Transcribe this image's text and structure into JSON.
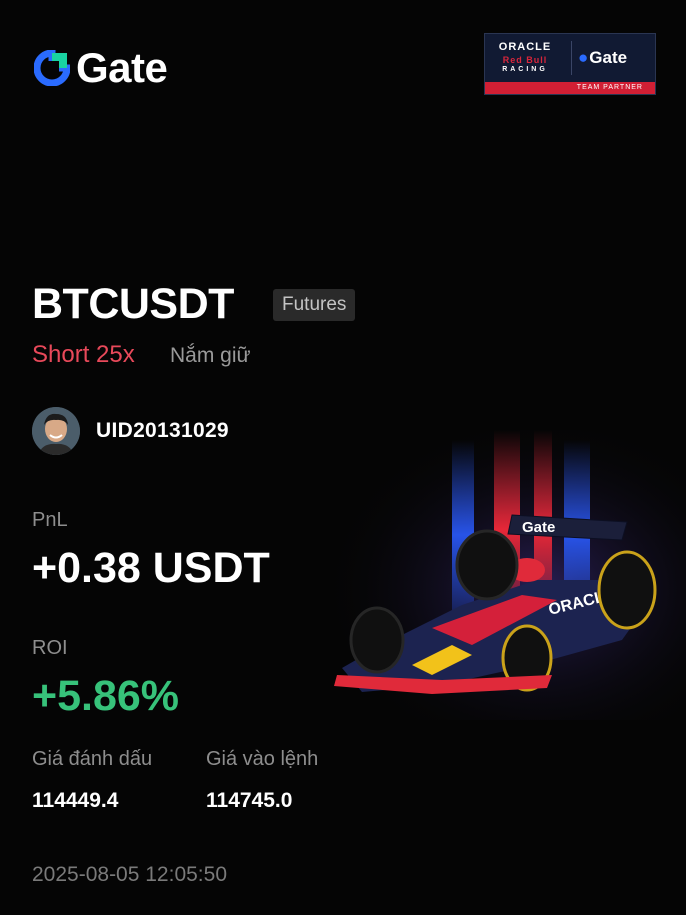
{
  "brand": {
    "name": "Gate",
    "logo_color": "#2a6bff",
    "mark_accent": "#19d3a2"
  },
  "partner_badge": {
    "oracle": "ORACLE",
    "redbull": "Red Bull",
    "racing": "RACING",
    "gate": "Gate",
    "team_partner": "TEAM PARTNER"
  },
  "position": {
    "pair": "BTCUSDT",
    "type_badge": "Futures",
    "side_leverage": "Short 25x",
    "status": "Nắm giữ",
    "side_color": "#e8495a"
  },
  "user": {
    "uid": "UID20131029",
    "avatar_icon": "user-avatar"
  },
  "pnl": {
    "label": "PnL",
    "value": "+0.38 USDT"
  },
  "roi": {
    "label": "ROI",
    "value": "+5.86%",
    "color": "#37c27a"
  },
  "prices": {
    "mark_label": "Giá đánh dấu",
    "mark_value": "114449.4",
    "entry_label": "Giá vào lệnh",
    "entry_value": "114745.0"
  },
  "timestamp": "2025-08-05 12:05:50",
  "illustration": {
    "car_sponsor_wing": "Gate",
    "car_sponsor_side": "ORACLE"
  }
}
